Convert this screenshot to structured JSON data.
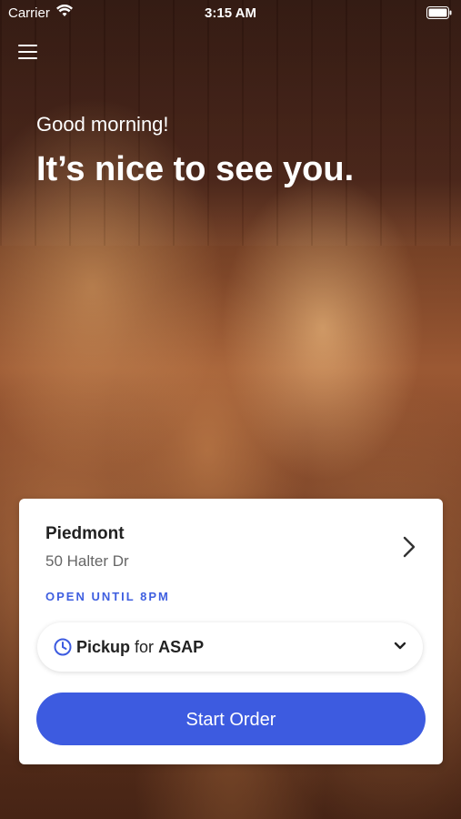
{
  "status_bar": {
    "carrier": "Carrier",
    "time": "3:15 AM"
  },
  "header": {
    "greeting": "Good morning!",
    "headline": "It’s nice to see you."
  },
  "store": {
    "name": "Piedmont",
    "address": "50 Halter Dr",
    "hours": "OPEN UNTIL 8PM"
  },
  "order": {
    "mode": "Pickup",
    "for_label": "for",
    "time": "ASAP",
    "start_label": "Start Order"
  },
  "colors": {
    "accent": "#3d5be0",
    "hours": "#3f5fe0"
  },
  "icons": {
    "menu": "hamburger-icon",
    "wifi": "wifi-icon",
    "battery": "battery-icon",
    "clock": "clock-icon",
    "chevron_right": "chevron-right-icon",
    "chevron_down": "chevron-down-icon"
  }
}
